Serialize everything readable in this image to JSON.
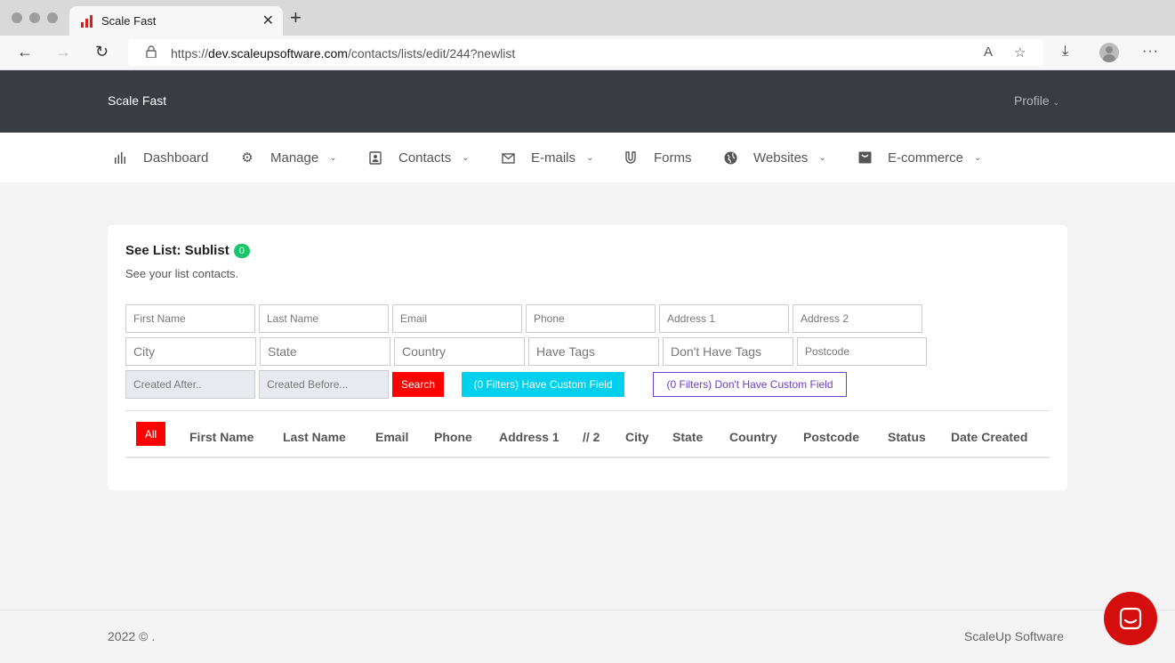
{
  "browser": {
    "tab_title": "Scale Fast",
    "url_prefix": "https://",
    "url_domain": "dev.scaleupsoftware.com",
    "url_path": "/contacts/lists/edit/244?newlist"
  },
  "header": {
    "brand": "Scale Fast",
    "profile": "Profile"
  },
  "menu": {
    "items": [
      {
        "label": "Dashboard",
        "icon": "bar-chart-icon"
      },
      {
        "label": "Manage",
        "icon": "gear-icon"
      },
      {
        "label": "Contacts",
        "icon": "contact-card-icon"
      },
      {
        "label": "E-mails",
        "icon": "envelope-icon"
      },
      {
        "label": "Forms",
        "icon": "magnet-icon"
      },
      {
        "label": "Websites",
        "icon": "globe-icon"
      },
      {
        "label": "E-commerce",
        "icon": "shopping-icon"
      }
    ]
  },
  "card": {
    "title": "See List: Sublist",
    "badge": "0",
    "subtitle": "See your list contacts."
  },
  "filters": {
    "first_name": "First Name",
    "last_name": "Last Name",
    "email": "Email",
    "phone": "Phone",
    "address1": "Address 1",
    "address2": "Address 2",
    "city": "City",
    "state": "State",
    "country": "Country",
    "have_tags": "Have Tags",
    "dont_have_tags": "Don't Have Tags",
    "postcode": "Postcode",
    "created_after": "Created After..",
    "created_before": "Created Before..."
  },
  "buttons": {
    "search": "Search",
    "have_custom": "(0 Filters) Have Custom Field",
    "dont_have_custom": "(0 Filters) Don't Have Custom Field",
    "all": "All"
  },
  "table": {
    "headers": [
      "First Name",
      "Last Name",
      "Email",
      "Phone",
      "Address 1",
      "// 2",
      "City",
      "State",
      "Country",
      "Postcode",
      "Status",
      "Date Created"
    ]
  },
  "footer": {
    "left": "2022 © .",
    "right": "ScaleUp Software"
  },
  "colors": {
    "header_bg": "#3a3c44",
    "accent_red": "#ff0000",
    "badge_green": "#1bc56c",
    "cyan": "#00d0ee",
    "purple": "#6b3fc7"
  }
}
